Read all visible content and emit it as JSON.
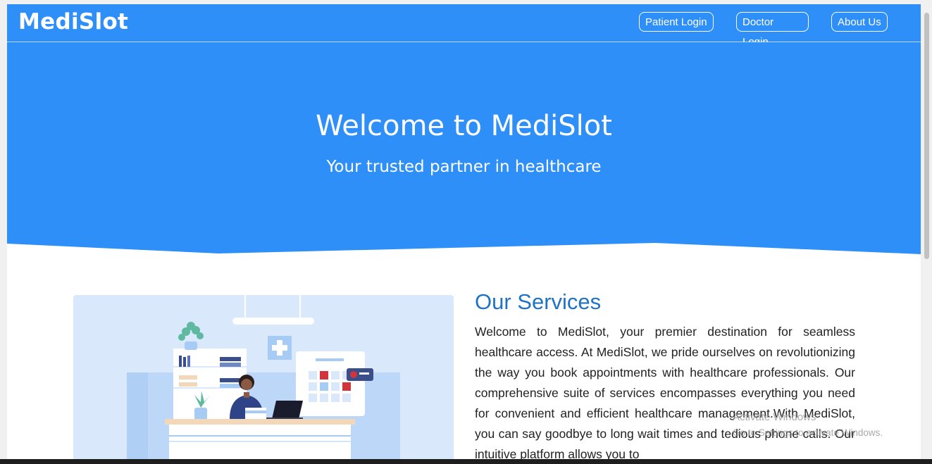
{
  "navbar": {
    "brand": "MediSlot",
    "buttons": [
      "Patient Login",
      "Doctor Login",
      "About Us"
    ]
  },
  "hero": {
    "title": "Welcome to MediSlot",
    "subtitle": "Your trusted partner in healthcare"
  },
  "services": {
    "title": "Our Services",
    "text": "Welcome to MediSlot, your premier destination for seamless healthcare access. At MediSlot, we pride ourselves on revolutionizing the way you book appointments with healthcare professionals. Our comprehensive suite of services encompasses everything you need for convenient and efficient healthcare management.With MediSlot, you can say goodbye to long wait times and tedious phone calls. Our intuitive platform allows you to"
  },
  "watermark": {
    "title": "Activate Windows",
    "subtitle": "Go to Settings to activate Windows."
  },
  "colors": {
    "primary": "#2f8ff9",
    "heading": "#1f73c6",
    "illustration_bg": "#d9e8fb"
  }
}
